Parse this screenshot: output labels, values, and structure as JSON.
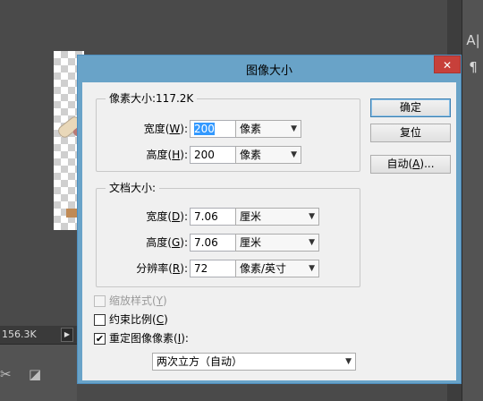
{
  "background": {
    "status_text": "156.3K",
    "status_arrow": "▶",
    "panel_tools": [
      "A|",
      "¶"
    ],
    "bottom_tools": [
      "✂",
      "◪"
    ]
  },
  "dialog": {
    "title": "图像大小",
    "close_label": "✕",
    "pixel_dimensions": {
      "legend": "像素大小:117.2K",
      "width": {
        "label": "宽度(",
        "key": "W",
        "suffix": "):",
        "value": "200",
        "unit": "像素"
      },
      "height": {
        "label": "高度(",
        "key": "H",
        "suffix": "):",
        "value": "200",
        "unit": "像素"
      }
    },
    "document_size": {
      "legend": "文档大小:",
      "width": {
        "label": "宽度(",
        "key": "D",
        "suffix": "):",
        "value": "7.06",
        "unit": "厘米"
      },
      "height": {
        "label": "高度(",
        "key": "G",
        "suffix": "):",
        "value": "7.06",
        "unit": "厘米"
      },
      "resolution": {
        "label": "分辨率(",
        "key": "R",
        "suffix": "):",
        "value": "72",
        "unit": "像素/英寸"
      }
    },
    "options": {
      "scale_styles": {
        "label": "缩放样式(",
        "key": "Y",
        "suffix": ")",
        "checked": false,
        "enabled": false
      },
      "constrain": {
        "label": "约束比例(",
        "key": "C",
        "suffix": ")",
        "checked": false,
        "enabled": true
      },
      "resample": {
        "label": "重定图像像素(",
        "key": "I",
        "suffix": "):",
        "checked": true,
        "enabled": true
      },
      "resample_method": "两次立方（自动）"
    },
    "buttons": {
      "ok": "确定",
      "reset": "复位",
      "auto_prefix": "自动(",
      "auto_key": "A",
      "auto_suffix": ")..."
    }
  }
}
